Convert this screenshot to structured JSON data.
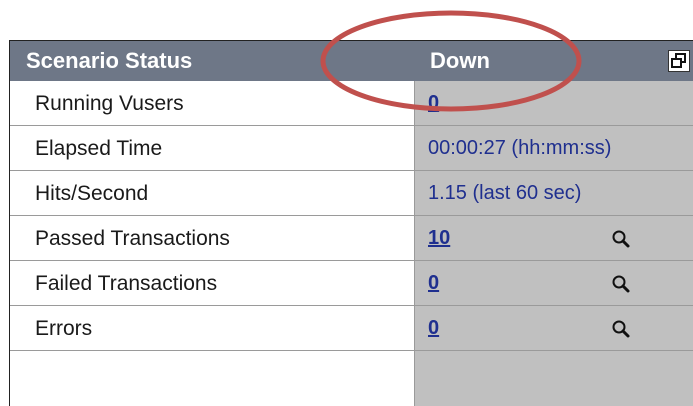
{
  "header": {
    "title": "Scenario Status",
    "status": "Down",
    "restore_icon": "restore-window-icon"
  },
  "rows": [
    {
      "label": "Running Vusers",
      "value": "0"
    },
    {
      "label": "Elapsed Time",
      "value": "00:00:27 (hh:mm:ss)"
    },
    {
      "label": "Hits/Second",
      "value": "1.15 (last 60 sec)"
    },
    {
      "label": "Passed Transactions",
      "value": "10",
      "icon": "magnifier-icon"
    },
    {
      "label": "Failed Transactions",
      "value": "0",
      "icon": "magnifier-icon"
    },
    {
      "label": "Errors",
      "value": "0",
      "icon": "magnifier-icon"
    }
  ],
  "colors": {
    "header_bg": "#6e7787",
    "value_bg": "#c0c0c0",
    "value_text": "#1f2f8f",
    "annotation": "#c0504d"
  }
}
